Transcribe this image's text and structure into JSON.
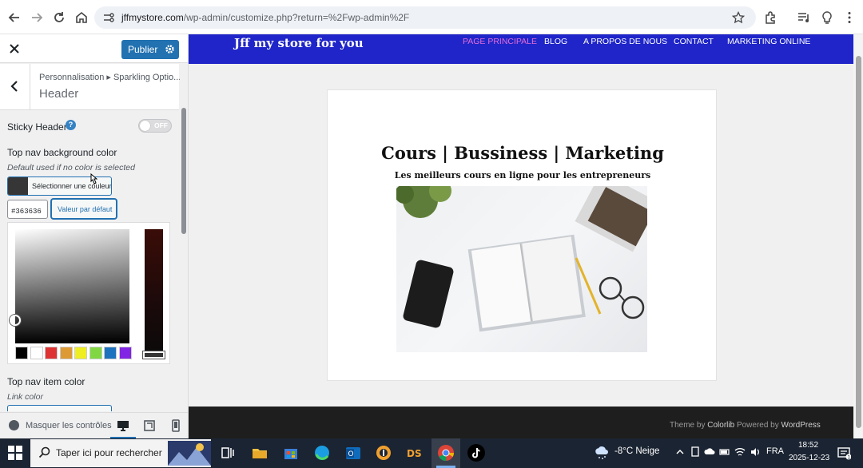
{
  "browser": {
    "url_host": "jffmystore.com",
    "url_path": "/wp-admin/customize.php?return=%2Fwp-admin%2F"
  },
  "customizer": {
    "publish_label": "Publier",
    "breadcrumb": "Personnalisation ▸ Sparkling Optio...",
    "section_title": "Header",
    "sticky_header": {
      "label": "Sticky Header",
      "help": "?",
      "toggle_text": "OFF",
      "state": "off"
    },
    "top_nav_bg": {
      "label": "Top nav background color",
      "description": "Default used if no color is selected",
      "select_color_label": "Sélectionner une couleur",
      "hex_value": "#363636",
      "default_button": "Valeur par défaut",
      "swatch_color": "#363636",
      "palette": [
        "#000000",
        "#ffffff",
        "#dd3333",
        "#dd9933",
        "#eeee22",
        "#81d742",
        "#1e73be",
        "#8224e3"
      ]
    },
    "top_nav_item": {
      "label": "Top nav item color",
      "description": "Link color"
    },
    "collapse_label": "Masquer les contrôles"
  },
  "site": {
    "brand": "Jff my store for you",
    "nav": [
      {
        "label": "PAGE PRINCIPALE",
        "active": true
      },
      {
        "label": "BLOG",
        "active": false
      },
      {
        "label": "A PROPOS DE NOUS",
        "active": false
      },
      {
        "label": "CONTACT",
        "active": false
      },
      {
        "label": "MARKETING ONLINE",
        "active": false
      }
    ],
    "hero_title": "Cours | Bussiness | Marketing",
    "hero_subtitle": "Les meilleurs cours en ligne pour les entrepreneurs",
    "footer_prefix": "Theme by",
    "footer_colorlib": "Colorlib",
    "footer_middle": "Powered by",
    "footer_wordpress": "WordPress",
    "header_color": "#1f25c8",
    "active_nav_color": "#e46bd7"
  },
  "taskbar": {
    "search_placeholder": "Taper ici pour rechercher",
    "weather": "-8°C  Neige",
    "language": "FRA",
    "time": "18:52",
    "date": "2025-12-23"
  }
}
